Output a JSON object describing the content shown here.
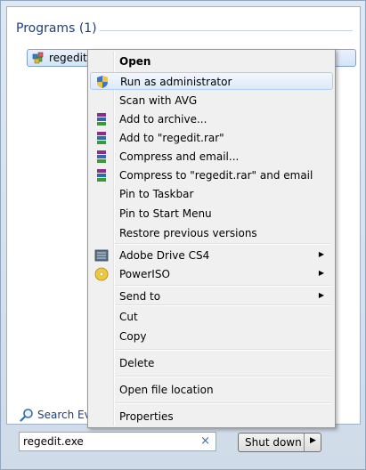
{
  "programs_header": "Programs (1)",
  "result": {
    "label": "regedit.exe"
  },
  "search_everywhere": "Search Every",
  "search": {
    "value": "regedit.exe",
    "clear": "×"
  },
  "shutdown": {
    "label": "Shut down",
    "arrow": "▶"
  },
  "context_menu": {
    "open": "Open",
    "run_as_admin": "Run as administrator",
    "scan_avg": "Scan with AVG",
    "add_archive": "Add to archive...",
    "add_rar": "Add to \"regedit.rar\"",
    "compress_email": "Compress and email...",
    "compress_rar_email": "Compress to \"regedit.rar\" and email",
    "pin_taskbar": "Pin to Taskbar",
    "pin_start": "Pin to Start Menu",
    "restore_versions": "Restore previous versions",
    "adobe_drive": "Adobe Drive CS4",
    "poweriso": "PowerISO",
    "send_to": "Send to",
    "cut": "Cut",
    "copy": "Copy",
    "delete": "Delete",
    "open_location": "Open file location",
    "properties": "Properties",
    "submenu_arrow": "▶"
  }
}
